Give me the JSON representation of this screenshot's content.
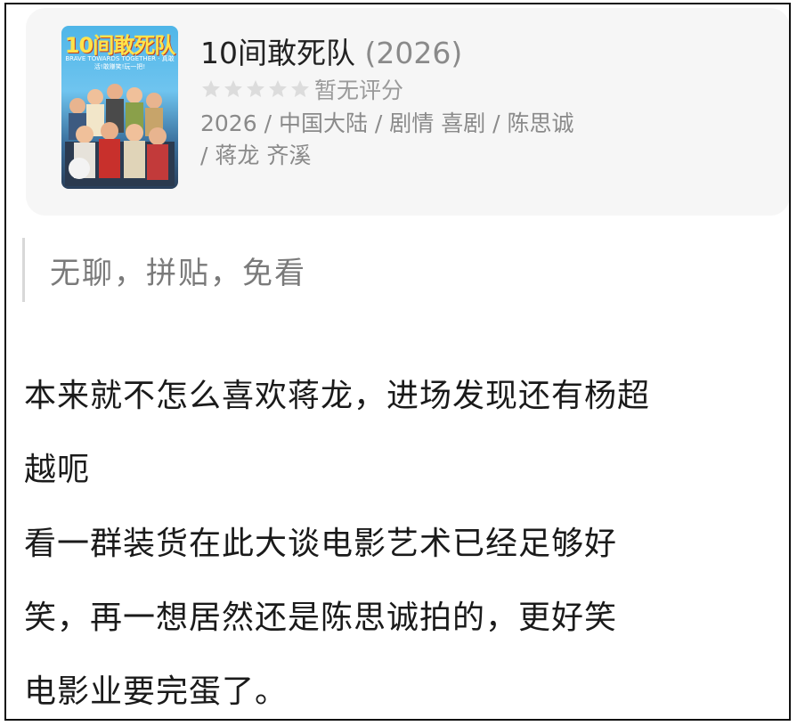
{
  "movie": {
    "poster_title": "10间敢死队",
    "poster_tagline": "BRAVE TOWARDS TOGETHER · 真敢活!敢赚笑!玩一把!",
    "title": "10间敢死队",
    "year": "(2026)",
    "rating": {
      "stars_filled": 0,
      "stars_total": 5,
      "text": "暂无评分"
    },
    "meta_lines": [
      "2026 / 中国大陆 / 剧情 喜剧 / 陈思诚",
      "/ 蒋龙 齐溪"
    ]
  },
  "quote": "无聊，拼贴，免看",
  "review_lines": [
    "本来就不怎么喜欢蒋龙，进场发现还有杨超",
    "越呃",
    "看一群装货在此大谈电影艺术已经足够好",
    "笑，再一想居然还是陈思诚拍的，更好笑",
    "电影业要完蛋了。"
  ],
  "colors": {
    "card_bg": "#f6f6f6",
    "star_empty": "#dcdcdc",
    "muted_text": "#8a8a8a",
    "quote_bar": "#d8d8d8"
  }
}
